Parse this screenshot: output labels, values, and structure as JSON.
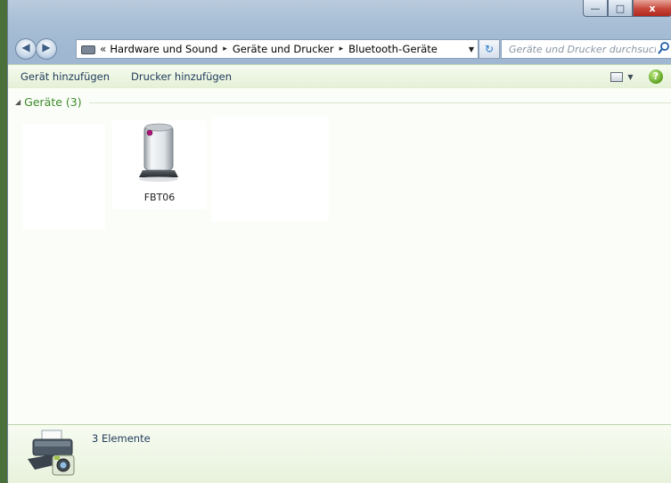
{
  "window": {
    "caption_buttons": {
      "minimize": "—",
      "maximize": "□",
      "close": "x"
    }
  },
  "address_bar": {
    "back_icon": "back-arrow-icon",
    "forward_icon": "forward-arrow-icon",
    "overflow": "«",
    "breadcrumbs": [
      "Hardware und Sound",
      "Geräte und Drucker",
      "Bluetooth-Geräte"
    ],
    "separator": "▸",
    "dropdown": "▼",
    "refresh": "↻"
  },
  "search": {
    "placeholder": "Geräte und Drucker durchsuchen"
  },
  "command_bar": {
    "add_device": "Gerät hinzufügen",
    "add_printer": "Drucker hinzufügen",
    "view_dropdown": "▼",
    "help": "?"
  },
  "group": {
    "arrow": "◢",
    "title": "Geräte (3)"
  },
  "devices": [
    {
      "label": ""
    },
    {
      "label": "FBT06"
    },
    {
      "label": ""
    }
  ],
  "details": {
    "count": "3 Elemente"
  },
  "colors": {
    "group_title": "#3b8b2a",
    "command_bar": "#e4f0d6",
    "close_button": "#c7463a"
  }
}
